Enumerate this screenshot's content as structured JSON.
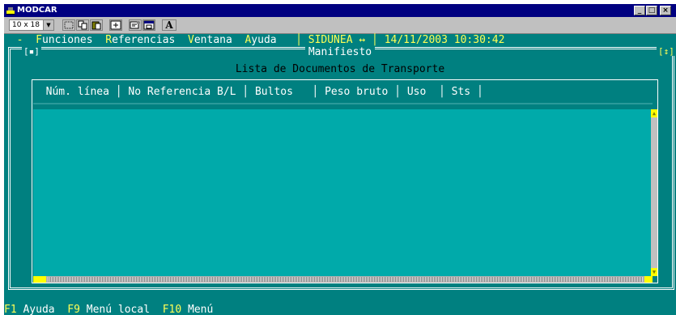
{
  "window": {
    "title": "MODCAR"
  },
  "toolbar": {
    "font_size": "10 x 18",
    "bold_tool_label": "A"
  },
  "menubar": {
    "items": [
      {
        "hot": "-",
        "rest": ""
      },
      {
        "hot": "F",
        "rest": "unciones"
      },
      {
        "hot": "R",
        "rest": "eferencias"
      },
      {
        "hot": "V",
        "rest": "entana"
      },
      {
        "hot": "A",
        "rest": "yuda"
      }
    ],
    "system": "SIDUNEA ↔",
    "datetime": "14/11/2003 10:30:42"
  },
  "frame": {
    "title": "Manifiesto",
    "subtitle": "Lista de Documentos de Transporte",
    "corner_left": "[▪]",
    "corner_right": "[↕]"
  },
  "table": {
    "columns": [
      "Núm. línea",
      "No Referencia B/L",
      "Bultos",
      "Peso bruto",
      "Uso",
      "Sts"
    ],
    "rows": []
  },
  "statusbar": {
    "keys": [
      {
        "key": "F1",
        "label": "Ayuda"
      },
      {
        "key": "F9",
        "label": "Menú local"
      },
      {
        "key": "F10",
        "label": "Menú"
      }
    ]
  }
}
